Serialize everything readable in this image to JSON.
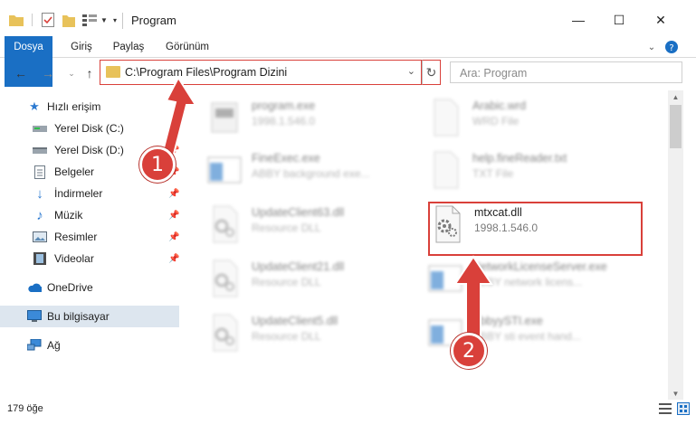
{
  "window": {
    "title": "Program",
    "minimize": "—",
    "maximize": "☐",
    "close": "✕"
  },
  "ribbon": {
    "tabs": [
      "Dosya",
      "Giriş",
      "Paylaş",
      "Görünüm"
    ]
  },
  "address": {
    "path": "C:\\Program Files\\Program Dizini",
    "search_placeholder": "Ara: Program"
  },
  "sidebar": {
    "items": [
      {
        "label": "Hızlı erişim",
        "icon": "star-icon"
      },
      {
        "label": "Yerel Disk (C:)",
        "icon": "drive-icon"
      },
      {
        "label": "Yerel Disk (D:)",
        "icon": "drive-icon"
      },
      {
        "label": "Belgeler",
        "icon": "documents-icon"
      },
      {
        "label": "İndirmeler",
        "icon": "download-icon"
      },
      {
        "label": "Müzik",
        "icon": "music-icon"
      },
      {
        "label": "Resimler",
        "icon": "pictures-icon"
      },
      {
        "label": "Videolar",
        "icon": "video-icon"
      },
      {
        "label": "OneDrive",
        "icon": "cloud-icon"
      },
      {
        "label": "Bu bilgisayar",
        "icon": "computer-icon"
      },
      {
        "label": "Ağ",
        "icon": "network-icon"
      }
    ]
  },
  "files": [
    {
      "name": "program.exe",
      "desc": "1998.1.546.0",
      "type": "exe"
    },
    {
      "name": "Arabic.wrd",
      "desc": "WRD File",
      "type": "doc"
    },
    {
      "name": "FineExec.exe",
      "desc": "ABBY background exe...",
      "type": "app"
    },
    {
      "name": "help.fineReader.txt",
      "desc": "TXT File",
      "type": "doc"
    },
    {
      "name": "UpdateClient63.dll",
      "desc": "Resource DLL",
      "type": "dll"
    },
    {
      "name": "mtxcat.dll",
      "desc": "1998.1.546.0",
      "type": "dll"
    },
    {
      "name": "UpdateClient21.dll",
      "desc": "Resource DLL",
      "type": "dll"
    },
    {
      "name": "NetworkLicenseServer.exe",
      "desc": "ABBY network licens...",
      "type": "app"
    },
    {
      "name": "UpdateClient5.dll",
      "desc": "Resource DLL",
      "type": "dll"
    },
    {
      "name": "AbbyySTI.exe",
      "desc": "ABBY sti event hand...",
      "type": "app"
    }
  ],
  "status": {
    "count": "179 öğe"
  },
  "annotations": {
    "badge1": "1",
    "badge2": "2",
    "color": "#d9403a"
  }
}
